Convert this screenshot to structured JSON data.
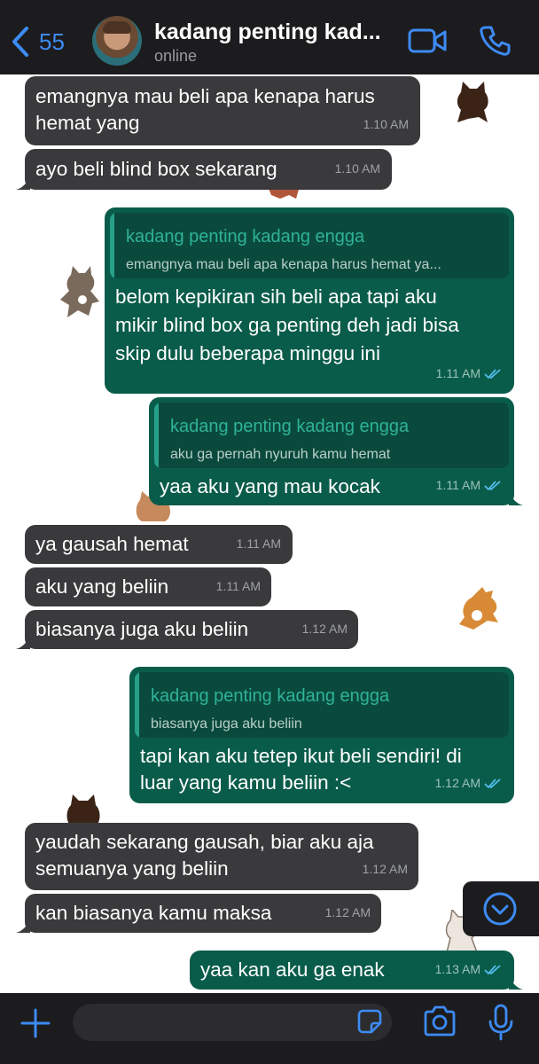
{
  "header": {
    "back_count": "55",
    "contact_name": "kadang penting kad...",
    "status": "online"
  },
  "messages": [
    {
      "dir": "in",
      "text_lines": [
        "emangnya mau beli apa kenapa harus",
        "hemat yang"
      ],
      "time": "1.10 AM"
    },
    {
      "dir": "in",
      "text_lines": [
        "ayo beli blind box sekarang"
      ],
      "time": "1.10 AM"
    },
    {
      "dir": "out",
      "quote": {
        "name": "kadang penting kadang engga",
        "text": "emangnya mau beli apa kenapa harus hemat ya..."
      },
      "text_lines": [
        "belom kepikiran sih beli apa tapi aku",
        "mikir blind box ga penting deh jadi bisa",
        "skip dulu beberapa minggu ini"
      ],
      "time": "1.11 AM"
    },
    {
      "dir": "out",
      "quote": {
        "name": "kadang penting kadang engga",
        "text": "aku ga pernah nyuruh kamu hemat"
      },
      "text_lines": [
        "yaa aku yang mau kocak"
      ],
      "time": "1.11 AM"
    },
    {
      "dir": "in",
      "text_lines": [
        "ya gausah hemat"
      ],
      "time": "1.11 AM"
    },
    {
      "dir": "in",
      "text_lines": [
        "aku yang beliin"
      ],
      "time": "1.11 AM"
    },
    {
      "dir": "in",
      "text_lines": [
        "biasanya juga aku beliin"
      ],
      "time": "1.12 AM"
    },
    {
      "dir": "out",
      "quote": {
        "name": "kadang penting kadang engga",
        "text": "biasanya juga aku beliin"
      },
      "text_lines": [
        "tapi kan aku tetep ikut beli sendiri! di",
        "luar yang kamu beliin :<"
      ],
      "time": "1.12 AM"
    },
    {
      "dir": "in",
      "text_lines": [
        "yaudah sekarang gausah, biar aku aja",
        "semuanya yang beliin"
      ],
      "time": "1.12 AM"
    },
    {
      "dir": "in",
      "text_lines": [
        "kan biasanya kamu maksa"
      ],
      "time": "1.12 AM"
    },
    {
      "dir": "out",
      "text_lines": [
        "yaa kan aku ga enak"
      ],
      "time": "1.13 AM"
    }
  ],
  "colors": {
    "accent": "#3d8bf5",
    "incoming_bubble": "#3a3a3c",
    "outgoing_bubble": "#0a5c4a",
    "quote_name": "#2fb398",
    "read_ticks": "#53bdeb"
  },
  "icons": [
    "back-chevron-icon",
    "video-call-icon",
    "phone-call-icon",
    "plus-icon",
    "sticker-icon",
    "camera-icon",
    "microphone-icon",
    "scroll-down-icon",
    "double-check-icon",
    "cat-sticker-icon"
  ]
}
